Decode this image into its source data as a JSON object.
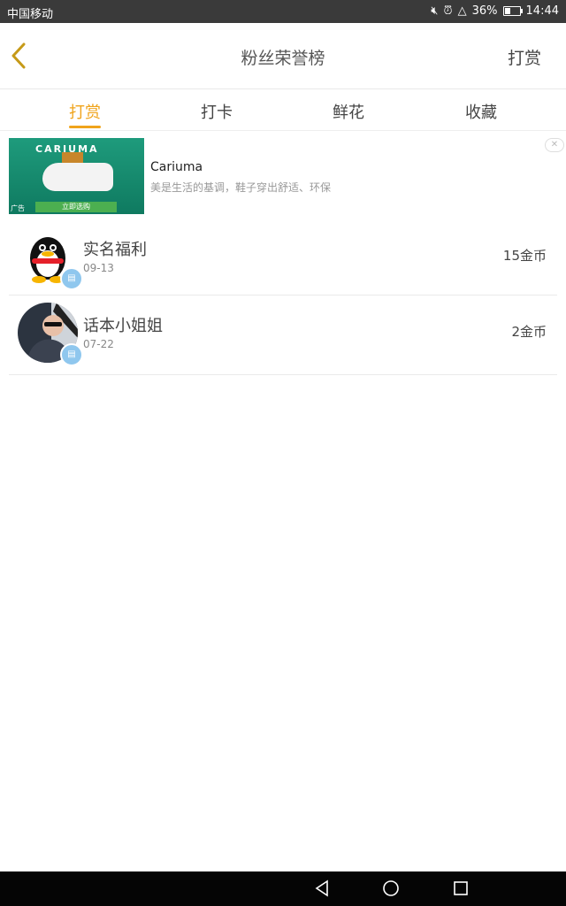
{
  "statusbar": {
    "carrier": "中国移动",
    "battery": "36%",
    "time": "14:44"
  },
  "header": {
    "title": "粉丝荣誉榜",
    "action": "打赏"
  },
  "tabs": [
    {
      "label": "打赏",
      "active": true
    },
    {
      "label": "打卡",
      "active": false
    },
    {
      "label": "鲜花",
      "active": false
    },
    {
      "label": "收藏",
      "active": false
    }
  ],
  "ad": {
    "brand_image_text": "CARIUMA",
    "cta_image_text": "立即选购",
    "tag": "广告",
    "name": "Cariuma",
    "desc": "美是生活的基调，鞋子穿出舒适、环保"
  },
  "list": [
    {
      "name": "实名福利",
      "date": "09-13",
      "amount": "15金币",
      "avatar_icon": "qq-penguin-icon"
    },
    {
      "name": "话本小姐姐",
      "date": "07-22",
      "amount": "2金币",
      "avatar_icon": "photo-avatar"
    }
  ],
  "colors": {
    "accent": "#f0a41c",
    "statusbar": "#3a3a3a",
    "badge": "#8fc7ee"
  }
}
